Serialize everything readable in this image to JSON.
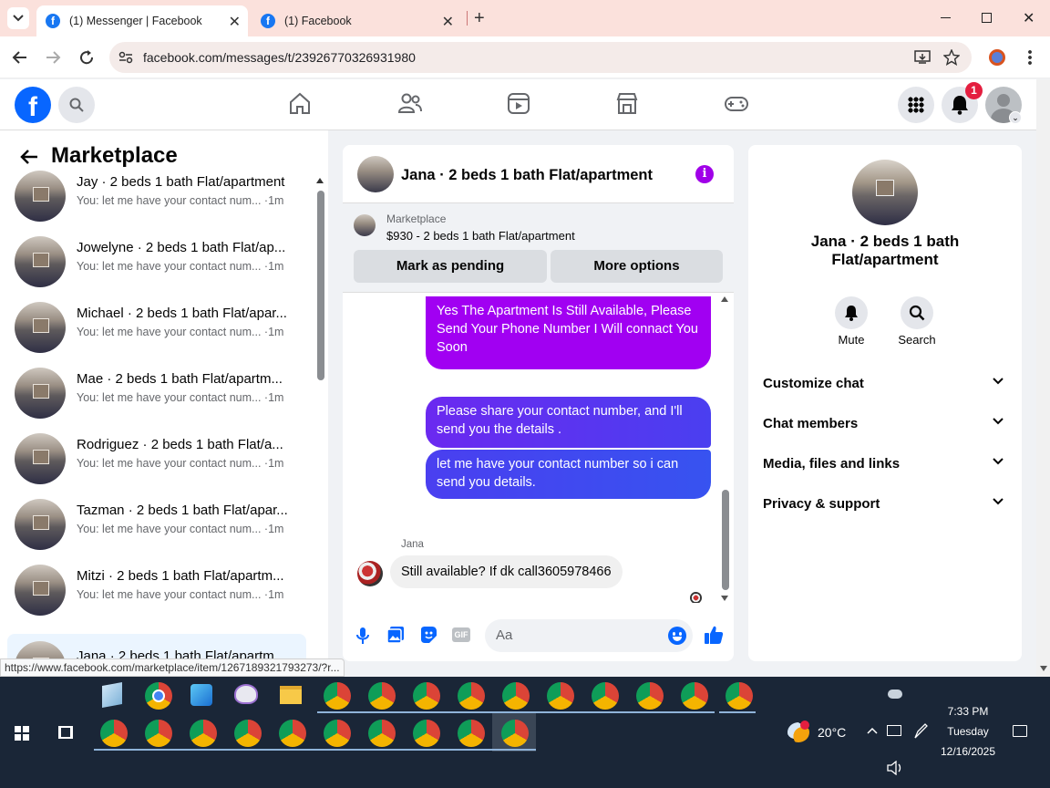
{
  "browser": {
    "tabs": [
      {
        "title": "(1) Messenger | Facebook"
      },
      {
        "title": "(1) Facebook"
      }
    ],
    "url": "facebook.com/messages/t/23926770326931980",
    "status_url": "https://www.facebook.com/marketplace/item/1267189321793273/?r..."
  },
  "fb": {
    "notification_count": "1"
  },
  "left": {
    "title": "Marketplace",
    "conversations": [
      {
        "name": "Jay · 2 beds 1 bath Flat/apartment",
        "preview": "You: let me have your contact num... ·1m"
      },
      {
        "name": "Jowelyne · 2 beds 1 bath Flat/ap...",
        "preview": "You: let me have your contact num... ·1m"
      },
      {
        "name": "Michael · 2 beds 1 bath Flat/apar...",
        "preview": "You: let me have your contact num... ·1m"
      },
      {
        "name": "Mae · 2 beds 1 bath Flat/apartm...",
        "preview": "You: let me have your contact num... ·1m"
      },
      {
        "name": "Rodriguez · 2 beds 1 bath Flat/a...",
        "preview": "You: let me have your contact num... ·1m"
      },
      {
        "name": "Tazman · 2 beds 1 bath Flat/apar...",
        "preview": "You: let me have your contact num... ·1m"
      },
      {
        "name": "Mitzi · 2 beds 1 bath Flat/apartm...",
        "preview": "You: let me have your contact num... ·1m"
      },
      {
        "name": "Jana · 2 beds 1 bath Flat/apartm...",
        "preview": ""
      }
    ]
  },
  "chat": {
    "title": "Jana · 2 beds 1 bath Flat/apartment",
    "listing_source": "Marketplace",
    "listing": "$930 - 2 beds 1 bath Flat/apartment",
    "mark_pending": "Mark as pending",
    "more_options": "More options",
    "messages_out": [
      "Yes The Apartment Is Still Available, Please Send Your Phone Number I Will connact You Soon",
      "Please share your contact number, and I'll send you the details .",
      "let me have your contact number so i can send you details."
    ],
    "sender_name": "Jana",
    "message_in": "Still available? If dk call3605978466",
    "composer_placeholder": "Aa",
    "gif_label": "GIF"
  },
  "info": {
    "title": "Jana · 2 beds 1 bath Flat/apartment",
    "mute": "Mute",
    "search": "Search",
    "rows": [
      "Customize chat",
      "Chat members",
      "Media, files and links",
      "Privacy & support"
    ]
  },
  "taskbar": {
    "temperature": "20°C",
    "time": "7:33 PM",
    "day": "Tuesday",
    "date": "12/16/2025"
  }
}
